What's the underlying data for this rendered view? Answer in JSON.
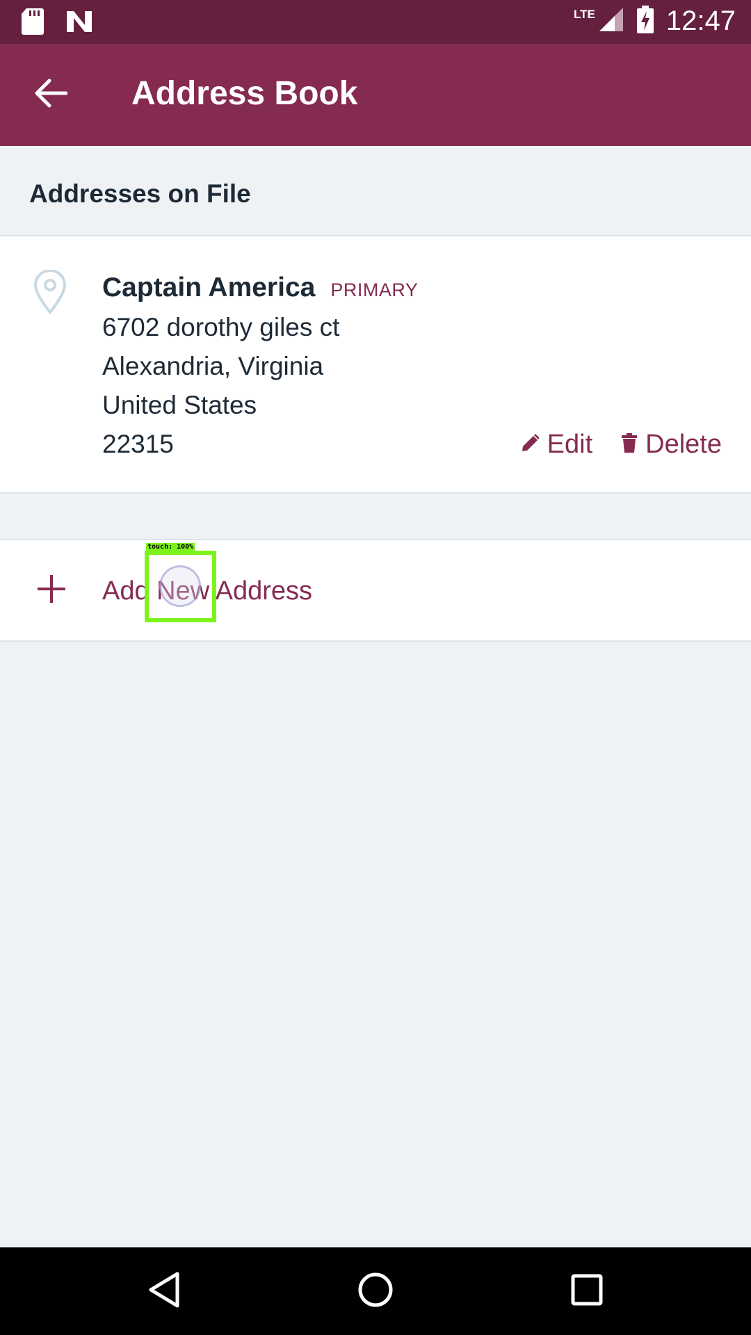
{
  "status_bar": {
    "time": "12:47",
    "network": "LTE",
    "icons": [
      "sd-card-icon",
      "n-notification-icon",
      "signal-icon",
      "battery-charging-icon"
    ]
  },
  "app_bar": {
    "title": "Address Book",
    "back_icon": "arrow-back-icon"
  },
  "section": {
    "title": "Addresses on File"
  },
  "address": {
    "name": "Captain America",
    "badge": "PRIMARY",
    "street": "6702 dorothy giles ct",
    "city_state": "Alexandria, Virginia",
    "country": "United States",
    "zip": "22315",
    "edit_label": "Edit",
    "delete_label": "Delete"
  },
  "add_address": {
    "label": "Add New Address"
  },
  "touch_indicator": {
    "label": "touch: 100%"
  },
  "nav_bar": {
    "icons": [
      "back-triangle-icon",
      "home-circle-icon",
      "recents-square-icon"
    ]
  },
  "colors": {
    "status_bar": "#65203f",
    "app_bar": "#852b51",
    "accent": "#852b51",
    "background": "#eff2f5",
    "text": "#1d2a36",
    "touch": "#7df31c"
  }
}
